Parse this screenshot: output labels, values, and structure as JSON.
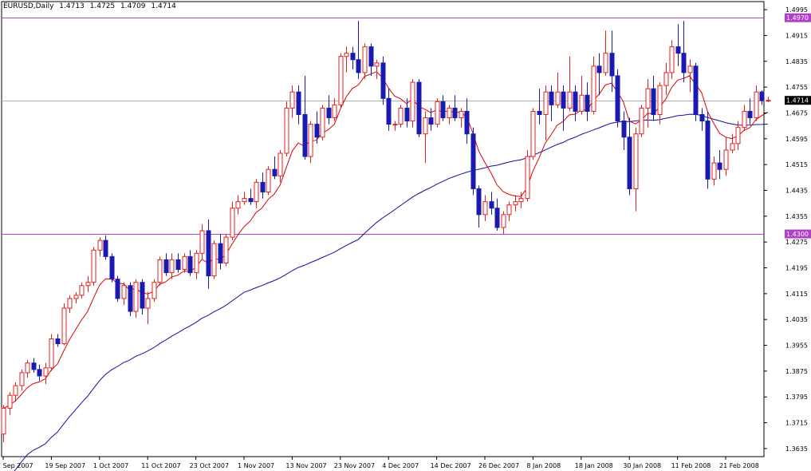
{
  "header": {
    "symbol": "EURUSD,Daily",
    "open": "1.4713",
    "high": "1.4725",
    "low": "1.4709",
    "close": "1.4714"
  },
  "colors": {
    "background": "#ffffff",
    "bull_candle": "#e02020",
    "bear_candle": "#1a1ab0",
    "fast_ma": "#e00000",
    "slow_ma": "#1010a0",
    "level_line": "#b040c8",
    "price_line": "#b0b0b0",
    "current_tag": "#000000",
    "level_tag": "#b040c8"
  },
  "chart_data": {
    "type": "candlestick",
    "symbol": "EURUSD",
    "timeframe": "Daily",
    "ylim": [
      1.361,
      1.502
    ],
    "y_ticks": [
      "1.4995",
      "1.4915",
      "1.4835",
      "1.4755",
      "1.4675",
      "1.4595",
      "1.4515",
      "1.4435",
      "1.4355",
      "1.4275",
      "1.4195",
      "1.4115",
      "1.4035",
      "1.3955",
      "1.3875",
      "1.3795",
      "1.3715",
      "1.3635"
    ],
    "x_ticks": [
      {
        "index": 0,
        "label": "7 Sep 2007"
      },
      {
        "index": 8,
        "label": "19 Sep 2007"
      },
      {
        "index": 16,
        "label": "1 Oct 2007"
      },
      {
        "index": 24,
        "label": "11 Oct 2007"
      },
      {
        "index": 32,
        "label": "23 Oct 2007"
      },
      {
        "index": 40,
        "label": "1 Nov 2007"
      },
      {
        "index": 48,
        "label": "13 Nov 2007"
      },
      {
        "index": 56,
        "label": "23 Nov 2007"
      },
      {
        "index": 64,
        "label": "4 Dec 2007"
      },
      {
        "index": 72,
        "label": "14 Dec 2007"
      },
      {
        "index": 80,
        "label": "26 Dec 2007"
      },
      {
        "index": 88,
        "label": "8 Jan 2008"
      },
      {
        "index": 96,
        "label": "18 Jan 2008"
      },
      {
        "index": 104,
        "label": "30 Jan 2008"
      },
      {
        "index": 112,
        "label": "11 Feb 2008"
      },
      {
        "index": 120,
        "label": "21 Feb 2008"
      }
    ],
    "levels": [
      {
        "value": 1.497,
        "label": "1.4970"
      },
      {
        "value": 1.43,
        "label": "1.4300"
      }
    ],
    "current_price": {
      "value": 1.4714,
      "label": "1.4714"
    },
    "candles": [
      [
        1.368,
        1.377,
        1.3655,
        1.376
      ],
      [
        1.376,
        1.381,
        1.374,
        1.38
      ],
      [
        1.38,
        1.384,
        1.378,
        1.383
      ],
      [
        1.383,
        1.388,
        1.3815,
        1.387
      ],
      [
        1.387,
        1.391,
        1.3855,
        1.39
      ],
      [
        1.39,
        1.3915,
        1.387,
        1.388
      ],
      [
        1.388,
        1.3895,
        1.3845,
        1.386
      ],
      [
        1.386,
        1.39,
        1.3835,
        1.3885
      ],
      [
        1.3885,
        1.399,
        1.3875,
        1.3975
      ],
      [
        1.3975,
        1.399,
        1.395,
        1.396
      ],
      [
        1.396,
        1.4085,
        1.3955,
        1.407
      ],
      [
        1.407,
        1.411,
        1.4055,
        1.41
      ],
      [
        1.41,
        1.412,
        1.4085,
        1.411
      ],
      [
        1.411,
        1.415,
        1.41,
        1.414
      ],
      [
        1.414,
        1.417,
        1.412,
        1.415
      ],
      [
        1.415,
        1.426,
        1.414,
        1.425
      ],
      [
        1.425,
        1.429,
        1.423,
        1.428
      ],
      [
        1.428,
        1.4295,
        1.422,
        1.423
      ],
      [
        1.423,
        1.424,
        1.415,
        1.416
      ],
      [
        1.416,
        1.417,
        1.409,
        1.41
      ],
      [
        1.41,
        1.415,
        1.408,
        1.414
      ],
      [
        1.414,
        1.415,
        1.4045,
        1.406
      ],
      [
        1.406,
        1.416,
        1.404,
        1.415
      ],
      [
        1.415,
        1.416,
        1.405,
        1.407
      ],
      [
        1.407,
        1.412,
        1.402,
        1.41
      ],
      [
        1.41,
        1.416,
        1.409,
        1.415
      ],
      [
        1.415,
        1.423,
        1.414,
        1.422
      ],
      [
        1.422,
        1.424,
        1.417,
        1.418
      ],
      [
        1.418,
        1.424,
        1.416,
        1.422
      ],
      [
        1.422,
        1.424,
        1.418,
        1.419
      ],
      [
        1.419,
        1.424,
        1.418,
        1.423
      ],
      [
        1.423,
        1.425,
        1.417,
        1.418
      ],
      [
        1.418,
        1.425,
        1.416,
        1.424
      ],
      [
        1.424,
        1.433,
        1.422,
        1.431
      ],
      [
        1.431,
        1.4345,
        1.413,
        1.417
      ],
      [
        1.417,
        1.428,
        1.416,
        1.427
      ],
      [
        1.427,
        1.43,
        1.419,
        1.421
      ],
      [
        1.421,
        1.43,
        1.42,
        1.429
      ],
      [
        1.429,
        1.44,
        1.428,
        1.438
      ],
      [
        1.438,
        1.442,
        1.436,
        1.44
      ],
      [
        1.44,
        1.443,
        1.439,
        1.441
      ],
      [
        1.441,
        1.444,
        1.439,
        1.44
      ],
      [
        1.44,
        1.447,
        1.438,
        1.446
      ],
      [
        1.446,
        1.449,
        1.441,
        1.443
      ],
      [
        1.443,
        1.451,
        1.442,
        1.45
      ],
      [
        1.45,
        1.454,
        1.447,
        1.448
      ],
      [
        1.448,
        1.456,
        1.446,
        1.455
      ],
      [
        1.455,
        1.471,
        1.454,
        1.469
      ],
      [
        1.469,
        1.476,
        1.466,
        1.474
      ],
      [
        1.474,
        1.476,
        1.464,
        1.467
      ],
      [
        1.467,
        1.479,
        1.453,
        1.454
      ],
      [
        1.454,
        1.465,
        1.452,
        1.464
      ],
      [
        1.464,
        1.468,
        1.458,
        1.46
      ],
      [
        1.46,
        1.47,
        1.459,
        1.469
      ],
      [
        1.469,
        1.473,
        1.464,
        1.466
      ],
      [
        1.466,
        1.472,
        1.465,
        1.47
      ],
      [
        1.47,
        1.486,
        1.469,
        1.485
      ],
      [
        1.485,
        1.488,
        1.48,
        1.486
      ],
      [
        1.486,
        1.488,
        1.481,
        1.484
      ],
      [
        1.484,
        1.496,
        1.478,
        1.48
      ],
      [
        1.48,
        1.489,
        1.478,
        1.488
      ],
      [
        1.488,
        1.489,
        1.479,
        1.482
      ],
      [
        1.482,
        1.484,
        1.478,
        1.483
      ],
      [
        1.483,
        1.485,
        1.47,
        1.472
      ],
      [
        1.472,
        1.475,
        1.462,
        1.464
      ],
      [
        1.464,
        1.465,
        1.462,
        1.464
      ],
      [
        1.464,
        1.47,
        1.463,
        1.469
      ],
      [
        1.469,
        1.472,
        1.463,
        1.465
      ],
      [
        1.465,
        1.478,
        1.463,
        1.477
      ],
      [
        1.477,
        1.478,
        1.46,
        1.461
      ],
      [
        1.461,
        1.468,
        1.452,
        1.466
      ],
      [
        1.466,
        1.469,
        1.462,
        1.464
      ],
      [
        1.464,
        1.472,
        1.463,
        1.471
      ],
      [
        1.471,
        1.473,
        1.465,
        1.466
      ],
      [
        1.466,
        1.47,
        1.464,
        1.469
      ],
      [
        1.469,
        1.473,
        1.465,
        1.466
      ],
      [
        1.466,
        1.469,
        1.463,
        1.468
      ],
      [
        1.468,
        1.472,
        1.458,
        1.461
      ],
      [
        1.461,
        1.463,
        1.442,
        1.444
      ],
      [
        1.444,
        1.445,
        1.432,
        1.436
      ],
      [
        1.436,
        1.442,
        1.434,
        1.44
      ],
      [
        1.44,
        1.443,
        1.436,
        1.438
      ],
      [
        1.438,
        1.441,
        1.431,
        1.432
      ],
      [
        1.432,
        1.437,
        1.43,
        1.436
      ],
      [
        1.436,
        1.44,
        1.434,
        1.439
      ],
      [
        1.439,
        1.442,
        1.437,
        1.44
      ],
      [
        1.44,
        1.443,
        1.438,
        1.441
      ],
      [
        1.441,
        1.456,
        1.44,
        1.454
      ],
      [
        1.454,
        1.469,
        1.453,
        1.468
      ],
      [
        1.468,
        1.475,
        1.464,
        1.467
      ],
      [
        1.467,
        1.476,
        1.459,
        1.474
      ],
      [
        1.474,
        1.476,
        1.465,
        1.47
      ],
      [
        1.47,
        1.48,
        1.469,
        1.474
      ],
      [
        1.474,
        1.476,
        1.462,
        1.469
      ],
      [
        1.469,
        1.485,
        1.468,
        1.474
      ],
      [
        1.474,
        1.476,
        1.465,
        1.468
      ],
      [
        1.468,
        1.479,
        1.467,
        1.473
      ],
      [
        1.473,
        1.477,
        1.465,
        1.468
      ],
      [
        1.468,
        1.485,
        1.467,
        1.482
      ],
      [
        1.482,
        1.486,
        1.473,
        1.48
      ],
      [
        1.48,
        1.493,
        1.479,
        1.486
      ],
      [
        1.486,
        1.493,
        1.474,
        1.479
      ],
      [
        1.479,
        1.481,
        1.463,
        1.465
      ],
      [
        1.465,
        1.468,
        1.456,
        1.46
      ],
      [
        1.46,
        1.466,
        1.442,
        1.444
      ],
      [
        1.444,
        1.463,
        1.437,
        1.461
      ],
      [
        1.461,
        1.47,
        1.46,
        1.469
      ],
      [
        1.469,
        1.478,
        1.463,
        1.475
      ],
      [
        1.475,
        1.479,
        1.465,
        1.467
      ],
      [
        1.467,
        1.477,
        1.464,
        1.476
      ],
      [
        1.476,
        1.483,
        1.473,
        1.48
      ],
      [
        1.48,
        1.49,
        1.478,
        1.488
      ],
      [
        1.488,
        1.495,
        1.482,
        1.486
      ],
      [
        1.486,
        1.496,
        1.477,
        1.48
      ],
      [
        1.48,
        1.484,
        1.474,
        1.482
      ],
      [
        1.482,
        1.483,
        1.465,
        1.467
      ],
      [
        1.467,
        1.469,
        1.462,
        1.465
      ],
      [
        1.465,
        1.468,
        1.444,
        1.447
      ],
      [
        1.447,
        1.454,
        1.445,
        1.452
      ],
      [
        1.452,
        1.456,
        1.447,
        1.45
      ],
      [
        1.45,
        1.46,
        1.448,
        1.456
      ],
      [
        1.456,
        1.461,
        1.455,
        1.458
      ],
      [
        1.458,
        1.465,
        1.456,
        1.463
      ],
      [
        1.463,
        1.47,
        1.462,
        1.468
      ],
      [
        1.468,
        1.472,
        1.464,
        1.466
      ],
      [
        1.466,
        1.476,
        1.465,
        1.474
      ],
      [
        1.474,
        1.4745,
        1.47,
        1.4713
      ],
      [
        1.4713,
        1.4725,
        1.4709,
        1.4714
      ]
    ],
    "fast_ma_label": "",
    "slow_ma_label": "",
    "grid": false
  }
}
